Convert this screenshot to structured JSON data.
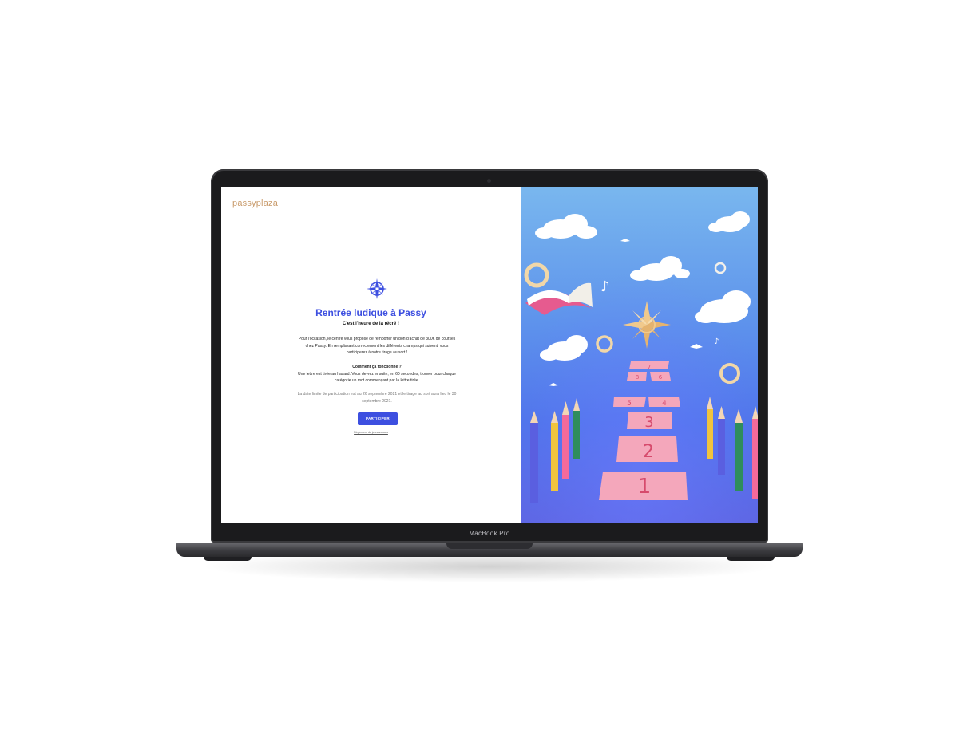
{
  "device": {
    "model_label": "MacBook Pro"
  },
  "page": {
    "logo": {
      "text": "passyplaza",
      "tagline": ""
    },
    "title": "Rentrée ludique à Passy",
    "subtitle": "C'est l'heure de la récré !",
    "intro": "Pour l'occasion, le centre vous propose de remporter un bon d'achat de 300€ de courses chez Passy. En remplissant correctement les différents champs qui suivent, vous participerez à notre tirage au sort !",
    "how_title": "Comment ça fonctionne ?",
    "how_text": "Une lettre est tirée au hasard. Vous devrez ensuite, en 60 secondes, trouver pour chaque catégorie un mot commençant par la lettre tirée.",
    "deadline": "La date limite de participation est au 26 septembre 2021 et le tirage au sort aura lieu le 30 septembre 2021.",
    "cta_label": "PARTICIPER",
    "rules_link": "Règlement du jeu-concours",
    "accent_color": "#3d4fe0",
    "logo_color": "#c89a6a"
  },
  "illustration": {
    "hopscotch_numbers": [
      "7",
      "8",
      "6",
      "5",
      "4",
      "3",
      "2",
      "1"
    ],
    "colors": {
      "sky_top": "#79b7ee",
      "sky_bottom": "#5d64e2",
      "tiles": "#f4a7bb"
    }
  }
}
